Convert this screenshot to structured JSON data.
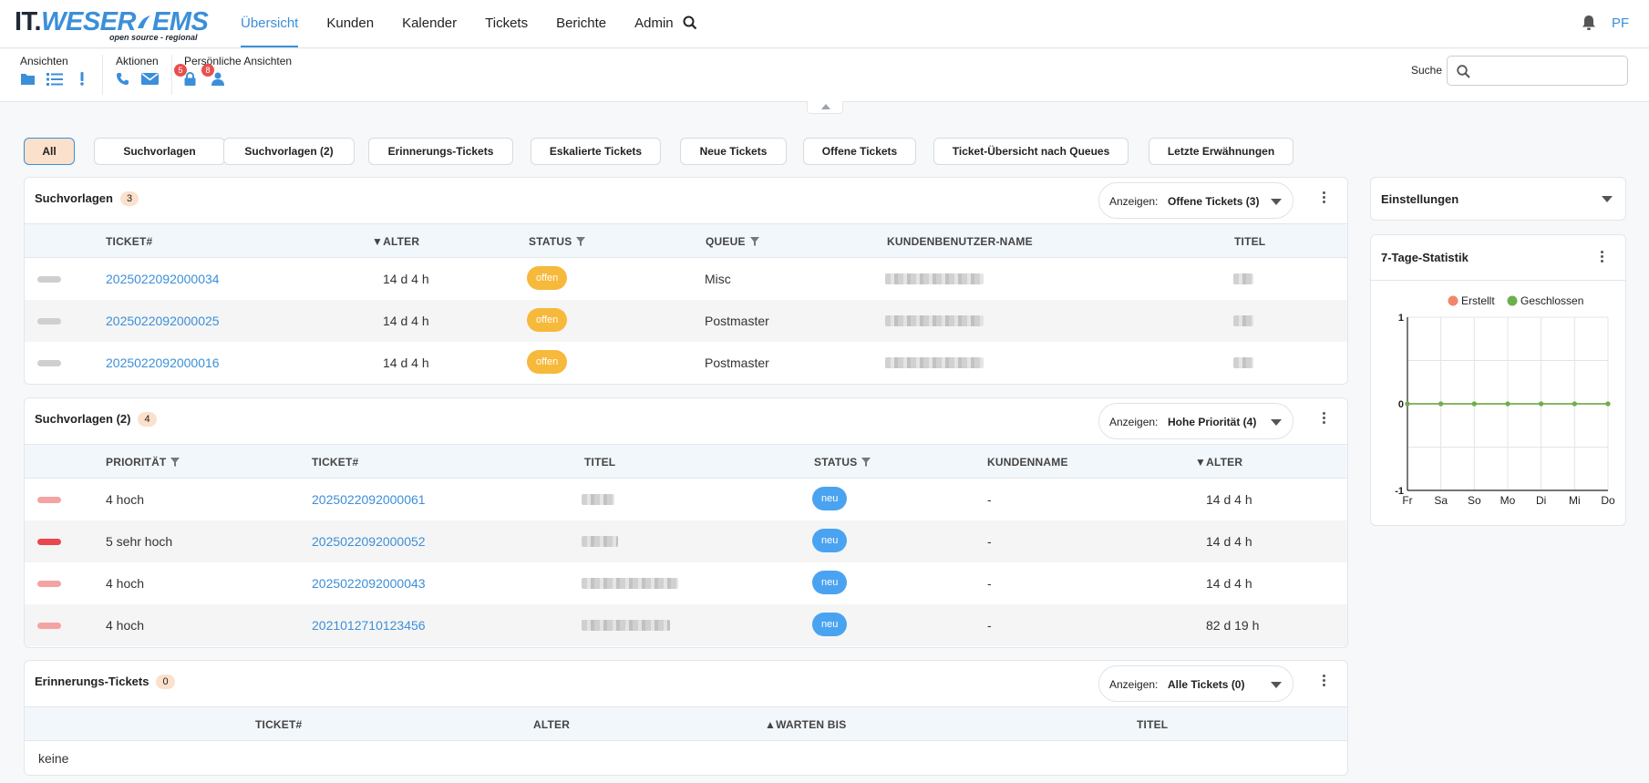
{
  "logo": {
    "part1": "IT.",
    "part2": "WESER",
    "part3": "EMS",
    "tagline": "open source - regional"
  },
  "nav": {
    "items": [
      "Übersicht",
      "Kunden",
      "Kalender",
      "Tickets",
      "Berichte",
      "Admin"
    ],
    "active": 0,
    "user_initials": "PF"
  },
  "toolbar": {
    "groups": [
      {
        "label": "Ansichten",
        "icons": [
          "folder-icon",
          "list-icon",
          "exclamation-icon"
        ]
      },
      {
        "label": "Aktionen",
        "icons": [
          "phone-icon",
          "envelope-icon"
        ]
      },
      {
        "label": "Persönliche Ansichten",
        "icons": [
          "lock-icon",
          "user-icon"
        ],
        "badges": [
          "5",
          "8"
        ]
      }
    ],
    "search_label": "Suche",
    "search_value": ""
  },
  "filters": [
    "All",
    "Suchvorlagen",
    "Suchvorlagen (2)",
    "Erinnerungs-Tickets",
    "Eskalierte Tickets",
    "Neue Tickets",
    "Offene Tickets",
    "Ticket-Übersicht nach Queues",
    "Letzte Erwähnungen"
  ],
  "widgets": {
    "suchvorlagen": {
      "title": "Suchvorlagen",
      "count": "3",
      "anzeigen_label": "Anzeigen:",
      "anzeigen_value": "Offene Tickets (3)",
      "columns": [
        "TICKET#",
        "▼ALTER",
        "STATUS",
        "QUEUE",
        "KUNDENBENUTZER-NAME",
        "TITEL"
      ],
      "rows": [
        {
          "ticket": "2025022092000034",
          "alter": "14 d 4 h",
          "status": "offen",
          "queue": "Misc"
        },
        {
          "ticket": "2025022092000025",
          "alter": "14 d 4 h",
          "status": "offen",
          "queue": "Postmaster"
        },
        {
          "ticket": "2025022092000016",
          "alter": "14 d 4 h",
          "status": "offen",
          "queue": "Postmaster"
        }
      ]
    },
    "suchvorlagen2": {
      "title": "Suchvorlagen (2)",
      "count": "4",
      "anzeigen_label": "Anzeigen:",
      "anzeigen_value": "Hohe Priorität (4)",
      "columns": [
        "PRIORITÄT",
        "TICKET#",
        "TITEL",
        "STATUS",
        "KUNDENNAME",
        "▼ALTER"
      ],
      "rows": [
        {
          "priority": "4 hoch",
          "ticket": "2025022092000061",
          "status": "neu",
          "kunde": "-",
          "alter": "14 d 4 h",
          "pri_color": "#f4a3a3"
        },
        {
          "priority": "5 sehr hoch",
          "ticket": "2025022092000052",
          "status": "neu",
          "kunde": "-",
          "alter": "14 d 4 h",
          "pri_color": "#e8474f"
        },
        {
          "priority": "4 hoch",
          "ticket": "2025022092000043",
          "status": "neu",
          "kunde": "-",
          "alter": "14 d 4 h",
          "pri_color": "#f4a3a3"
        },
        {
          "priority": "4 hoch",
          "ticket": "2021012710123456",
          "status": "neu",
          "kunde": "-",
          "alter": "82 d 19 h",
          "pri_color": "#f4a3a3"
        }
      ]
    },
    "erinnerung": {
      "title": "Erinnerungs-Tickets",
      "count": "0",
      "anzeigen_label": "Anzeigen:",
      "anzeigen_value": "Alle Tickets (0)",
      "columns": [
        "TICKET#",
        "ALTER",
        "▲WARTEN BIS",
        "TITEL"
      ],
      "empty_text": "keine"
    }
  },
  "sidebar": {
    "settings_title": "Einstellungen",
    "stats_title": "7-Tage-Statistik"
  },
  "chart_data": {
    "type": "line",
    "x": [
      "Fr",
      "Sa",
      "So",
      "Mo",
      "Di",
      "Mi",
      "Do"
    ],
    "series": [
      {
        "name": "Erstellt",
        "values": [
          0,
          0,
          0,
          0,
          0,
          0,
          0
        ],
        "color": "#f0876a"
      },
      {
        "name": "Geschlossen",
        "values": [
          0,
          0,
          0,
          0,
          0,
          0,
          0
        ],
        "color": "#6ab04c"
      }
    ],
    "ylim": [
      -1,
      1
    ],
    "yticks": [
      "1",
      "0",
      "-1"
    ],
    "grid": true,
    "legend": "top"
  },
  "colors": {
    "accent": "#3b8fd9",
    "status_offen": "#f6b93b",
    "status_neu": "#4aa3f0",
    "count_badge": "#fbe1cb"
  }
}
